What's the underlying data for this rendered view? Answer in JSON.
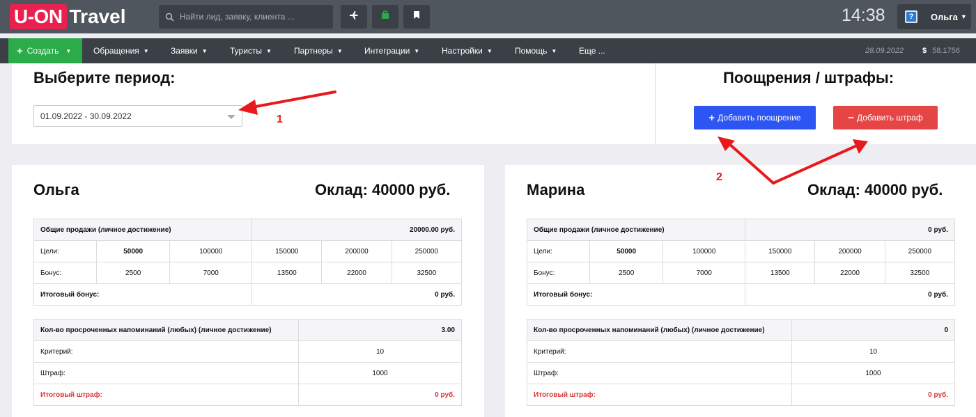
{
  "header": {
    "logo_box": "U-ON",
    "logo_text": "Travel",
    "search_placeholder": "Найти лид, заявку, клиента ...",
    "clock": "14:38",
    "user": "Ольга",
    "icons": [
      "search-icon",
      "plane-icon",
      "bag-icon",
      "bookmark-icon",
      "help-icon"
    ]
  },
  "nav": {
    "create": "Создать",
    "items": [
      "Обращения",
      "Заявки",
      "Туристы",
      "Партнеры",
      "Интеграции",
      "Настройки",
      "Помощь",
      "Еще ..."
    ],
    "date": "28.09.2022",
    "currency_symbol": "$",
    "rate": "58.1756"
  },
  "period": {
    "title": "Выберите период:",
    "value": "01.09.2022 - 30.09.2022"
  },
  "rewards": {
    "title": "Поощрения / штрафы:",
    "add_reward": "Добавить поощрение",
    "add_penalty": "Добавить штраф"
  },
  "annotations": {
    "one": "1",
    "two": "2"
  },
  "employees": [
    {
      "name": "Ольга",
      "salary": "Оклад: 40000 руб.",
      "sales_title": "Общие продажи (личное достижение)",
      "sales_value": "20000.00 руб.",
      "goals_label": "Цели:",
      "goals": [
        "50000",
        "100000",
        "150000",
        "200000",
        "250000"
      ],
      "bonus_label": "Бонус:",
      "bonuses": [
        "2500",
        "7000",
        "13500",
        "22000",
        "32500"
      ],
      "total_bonus_label": "Итоговый бонус:",
      "total_bonus": "0 руб.",
      "overdue_title": "Кол-во просроченных напоминаний (любых) (личное достижение)",
      "overdue_value": "3.00",
      "criterion_label": "Критерий:",
      "criterion": "10",
      "penalty_label": "Штраф:",
      "penalty": "1000",
      "total_penalty_label": "Итоговый штраф:",
      "total_penalty": "0 руб."
    },
    {
      "name": "Марина",
      "salary": "Оклад: 40000 руб.",
      "sales_title": "Общие продажи (личное достижение)",
      "sales_value": "0 руб.",
      "goals_label": "Цели:",
      "goals": [
        "50000",
        "100000",
        "150000",
        "200000",
        "250000"
      ],
      "bonus_label": "Бонус:",
      "bonuses": [
        "2500",
        "7000",
        "13500",
        "22000",
        "32500"
      ],
      "total_bonus_label": "Итоговый бонус:",
      "total_bonus": "0 руб.",
      "overdue_title": "Кол-во просроченных напоминаний (любых) (личное достижение)",
      "overdue_value": "0",
      "criterion_label": "Критерий:",
      "criterion": "10",
      "penalty_label": "Штраф:",
      "penalty": "1000",
      "total_penalty_label": "Итоговый штраф:",
      "total_penalty": "0 руб."
    }
  ]
}
